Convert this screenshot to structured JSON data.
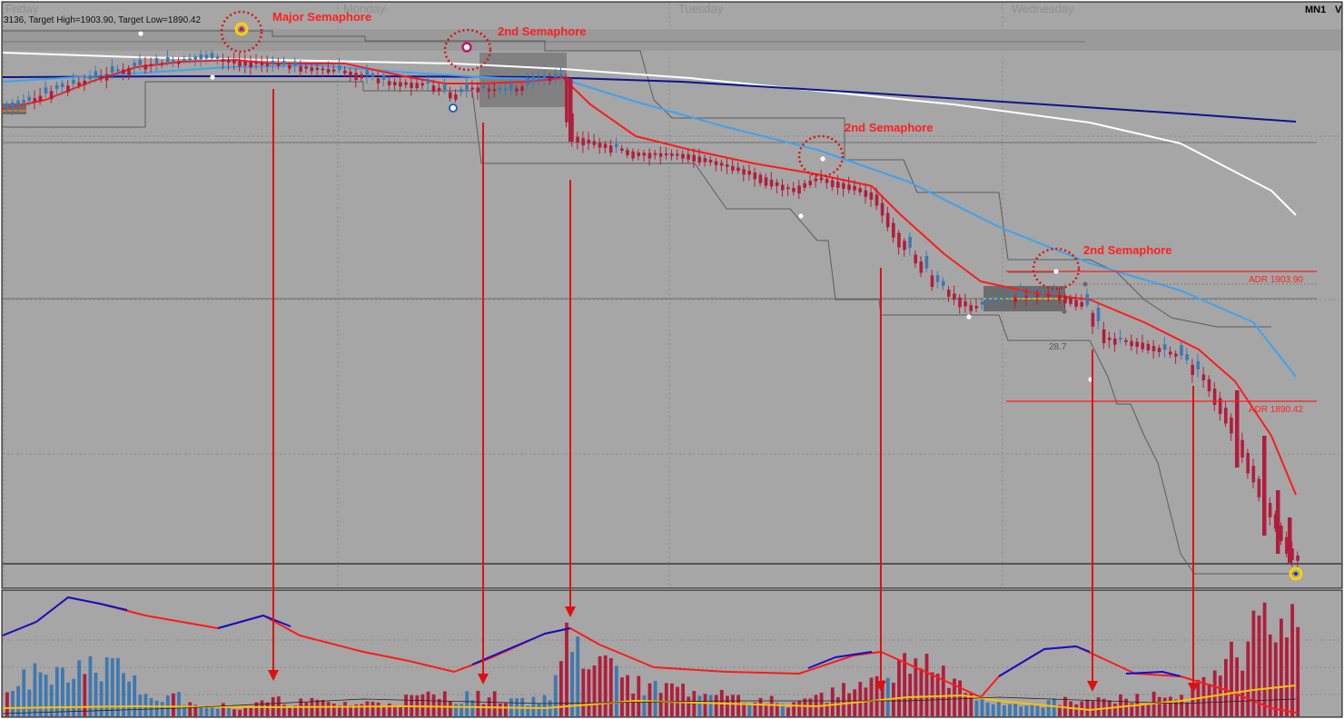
{
  "header": {
    "info_text": "3136, Target High=1903.90, Target Low=1890.42",
    "timeframe_label": "MN1",
    "corner_label": "V"
  },
  "colors": {
    "background": "#a6a6a6",
    "bear_candle": "#b01e3c",
    "bull_candle": "#3f78b0",
    "ema_fast": "#ff1a1a",
    "ema_mid": "#3fa2ee",
    "ema_slow_white": "#ffffff",
    "ema_slow_navy": "#11118e",
    "channel": "#5c5c5c",
    "adr_line": "#ff1a1a",
    "semaphore_circle": "#e01010",
    "arrow": "#e01010",
    "volume_avg": "#ffc000",
    "zone": "#7d7d7d"
  },
  "chart_data": [
    {
      "type": "candlestick",
      "title": "",
      "x_axis": {
        "type": "time",
        "tick_labels": [
          "Friday",
          "Monday",
          "Tuesday",
          "Wednesday"
        ]
      },
      "y_axis": {
        "visible": false,
        "range": [
          1878,
          1925
        ]
      },
      "overlays": [
        "fast EMA (red)",
        "mid EMA (light blue)",
        "slow EMA (white)",
        "slow EMA (navy)",
        "price channel (grey)"
      ],
      "adr_levels": [
        {
          "label": "ADR 1903.90",
          "value": 1903.9
        },
        {
          "label": "ADR 1890.42",
          "value": 1890.42
        }
      ],
      "range_box_label": "28.7",
      "annotations": [
        {
          "text": "Major Semaphore"
        },
        {
          "text": "2nd Semaphore"
        },
        {
          "text": "2nd Semaphore"
        },
        {
          "text": "2nd Semaphore"
        }
      ]
    },
    {
      "type": "bar",
      "title": "",
      "description_series": [
        "volume bars (blue = up, red = down)",
        "volume moving average (yellow)",
        "momentum oscillator line (blue/red)"
      ],
      "y_axis": {
        "visible": false,
        "range": [
          0,
          100
        ]
      }
    }
  ]
}
